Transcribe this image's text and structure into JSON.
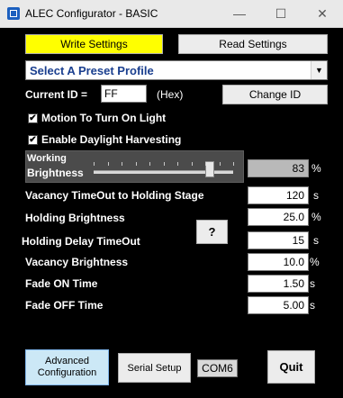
{
  "window": {
    "title": "ALEC Configurator - BASIC",
    "minimize": "—",
    "maximize": "☐",
    "close": "✕"
  },
  "toolbar": {
    "write_label": "Write Settings",
    "read_label": "Read Settings"
  },
  "preset": {
    "selected": "Select A Preset Profile",
    "arrow": "▼"
  },
  "id": {
    "label": "Current ID =",
    "value": "FF",
    "hex_label": "(Hex)",
    "change_label": "Change ID"
  },
  "options": {
    "motion_label": "Motion To Turn On Light",
    "motion_checked": true,
    "daylight_label": "Enable Daylight Harvesting",
    "daylight_checked": true,
    "check_glyph": "✔"
  },
  "working_brightness": {
    "label_line1": "Working",
    "label_line2": "Brightness",
    "slider_fraction": 0.83,
    "value": "83",
    "unit": "%"
  },
  "settings": [
    {
      "label": "Vacancy TimeOut to Holding Stage",
      "value": "120",
      "unit": "s"
    },
    {
      "label": "Holding Brightness",
      "value": "25.0",
      "unit": "%"
    },
    {
      "label": "Holding Delay TimeOut",
      "value": "15",
      "unit": "s"
    },
    {
      "label": "Vacancy Brightness",
      "value": "10.0",
      "unit": "%"
    },
    {
      "label": "Fade ON Time",
      "value": "1.50",
      "unit": "s"
    },
    {
      "label": "Fade OFF Time",
      "value": "5.00",
      "unit": "s"
    }
  ],
  "help_label": "?",
  "footer": {
    "advanced_line1": "Advanced",
    "advanced_line2": "Configuration",
    "serial_label": "Serial Setup",
    "com_port": "COM6",
    "quit_label": "Quit"
  },
  "colors": {
    "accent_yellow": "#ffff00",
    "advanced_blue": "#cce8f6",
    "select_text": "#1a3f8f"
  }
}
